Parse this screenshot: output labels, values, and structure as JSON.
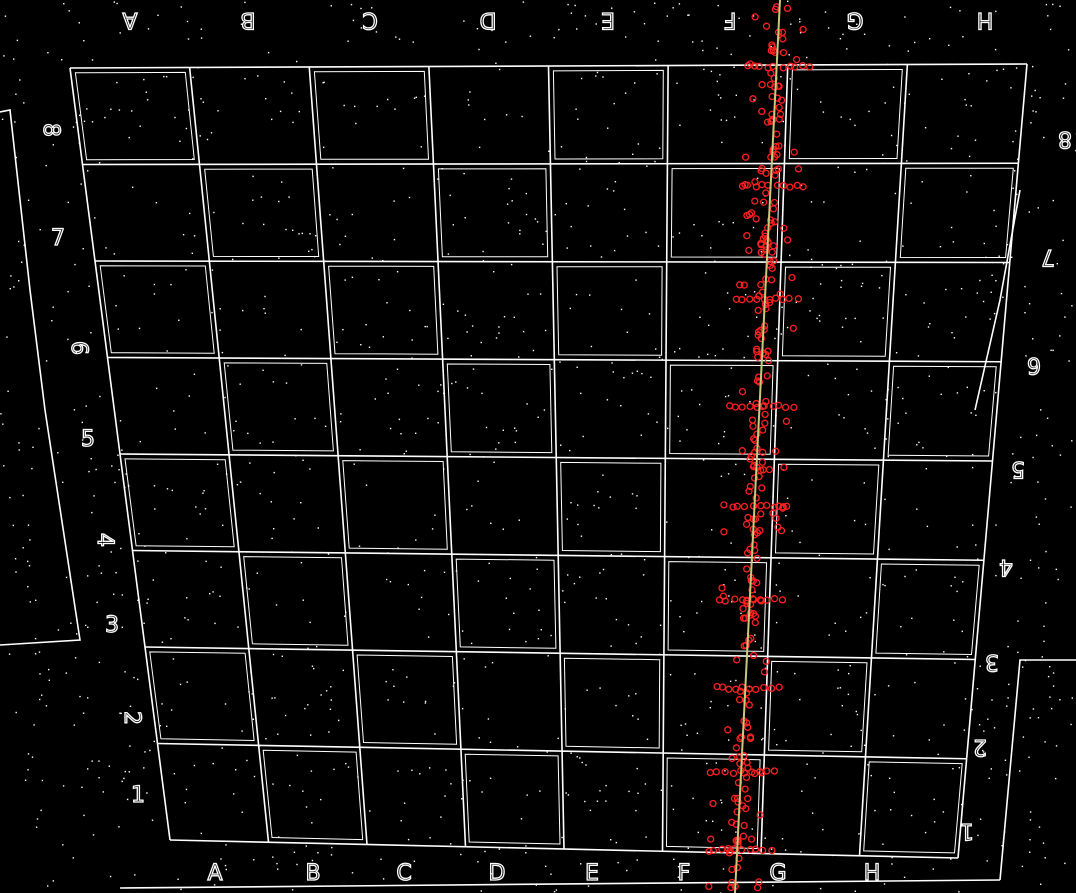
{
  "image": {
    "description_free": true,
    "background_color": "#000000",
    "edge_color": "#ffffff",
    "marker_color": "#ff1a1a",
    "fit_line_color": "#c8c87a"
  },
  "board": {
    "files_bottom": [
      "A",
      "B",
      "C",
      "D",
      "E",
      "F",
      "G",
      "H"
    ],
    "files_top_mirrored": [
      "A",
      "B",
      "C",
      "D",
      "E",
      "F",
      "G",
      "H"
    ],
    "ranks_left": [
      "8",
      "7",
      "6",
      "5",
      "4",
      "3",
      "2",
      "1"
    ],
    "ranks_right_mirrored": [
      "8",
      "7",
      "6",
      "5",
      "4",
      "3",
      "2",
      "1"
    ]
  }
}
